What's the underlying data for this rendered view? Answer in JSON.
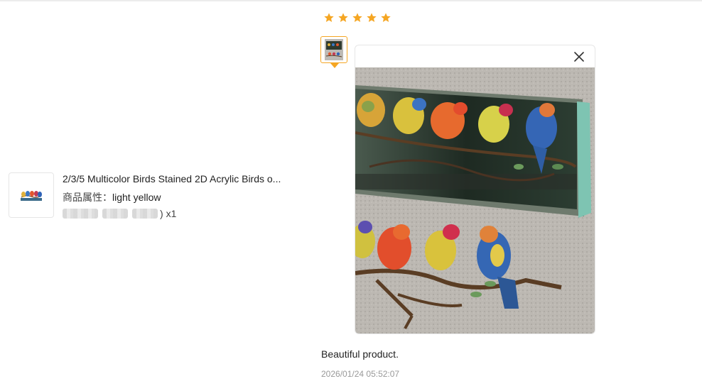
{
  "product": {
    "title": "2/3/5 Multicolor Birds Stained 2D Acrylic Birds o...",
    "attr_label": "商品属性：",
    "attr_value": "light yellow",
    "paren_close": ")",
    "quantity": "x1"
  },
  "review": {
    "rating": 5,
    "max_rating": 5,
    "text": "Beautiful product.",
    "date": "2026/01/24 05:52:07"
  },
  "colors": {
    "star": "#f5a623",
    "thumb_border": "#f5a623",
    "muted_text": "#999999"
  },
  "icons": {
    "close": "close-icon",
    "star": "star-icon"
  }
}
